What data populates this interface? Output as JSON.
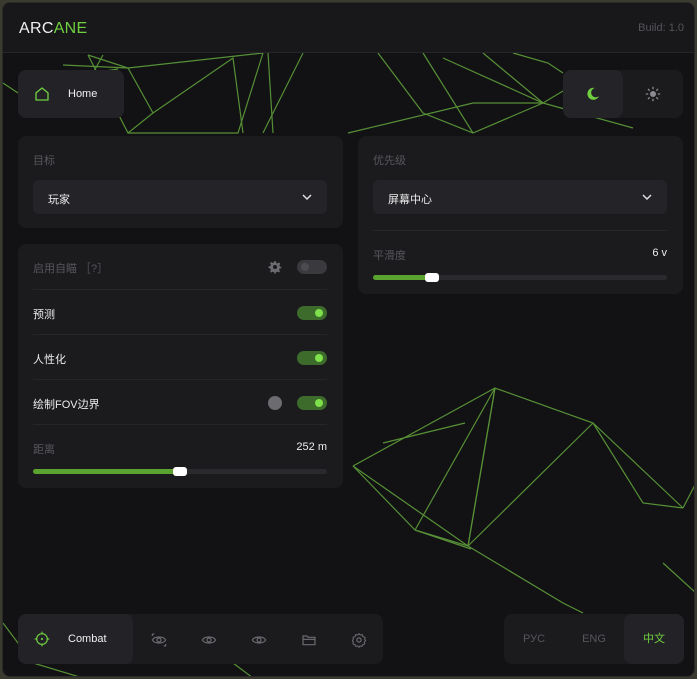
{
  "app": {
    "logo_part1": "ARC",
    "logo_part2": "ANE",
    "build": "Build: 1.0",
    "accent_color": "#6fcf3f"
  },
  "header": {
    "home_label": "Home",
    "home_icon": "home-icon",
    "theme": {
      "dark_icon": "moon-icon",
      "light_icon": "sun-icon",
      "selected": "dark"
    }
  },
  "target": {
    "label": "目标",
    "value": "玩家"
  },
  "priority": {
    "label": "优先级",
    "value": "屏幕中心"
  },
  "smoothness": {
    "label": "平滑度",
    "value_text": "6 v",
    "fill": 0.2
  },
  "options": {
    "enable_label": "启用自瞄 ［?］",
    "enable_on": false,
    "predict_label": "预测",
    "predict_on": true,
    "humanize_label": "人性化",
    "humanize_on": true,
    "fov_label": "绘制FOV边界",
    "fov_on": true,
    "distance_label": "距离",
    "distance_value_text": "252 m",
    "distance_fill": 0.5
  },
  "bottom_nav": {
    "combat_label": "Combat",
    "icons": [
      "crosshair-icon",
      "eye-icon",
      "eye-icon",
      "eye-icon",
      "folder-icon",
      "gear-icon"
    ]
  },
  "languages": {
    "items": [
      "РУС",
      "ENG",
      "中文"
    ],
    "selected": "中文"
  }
}
